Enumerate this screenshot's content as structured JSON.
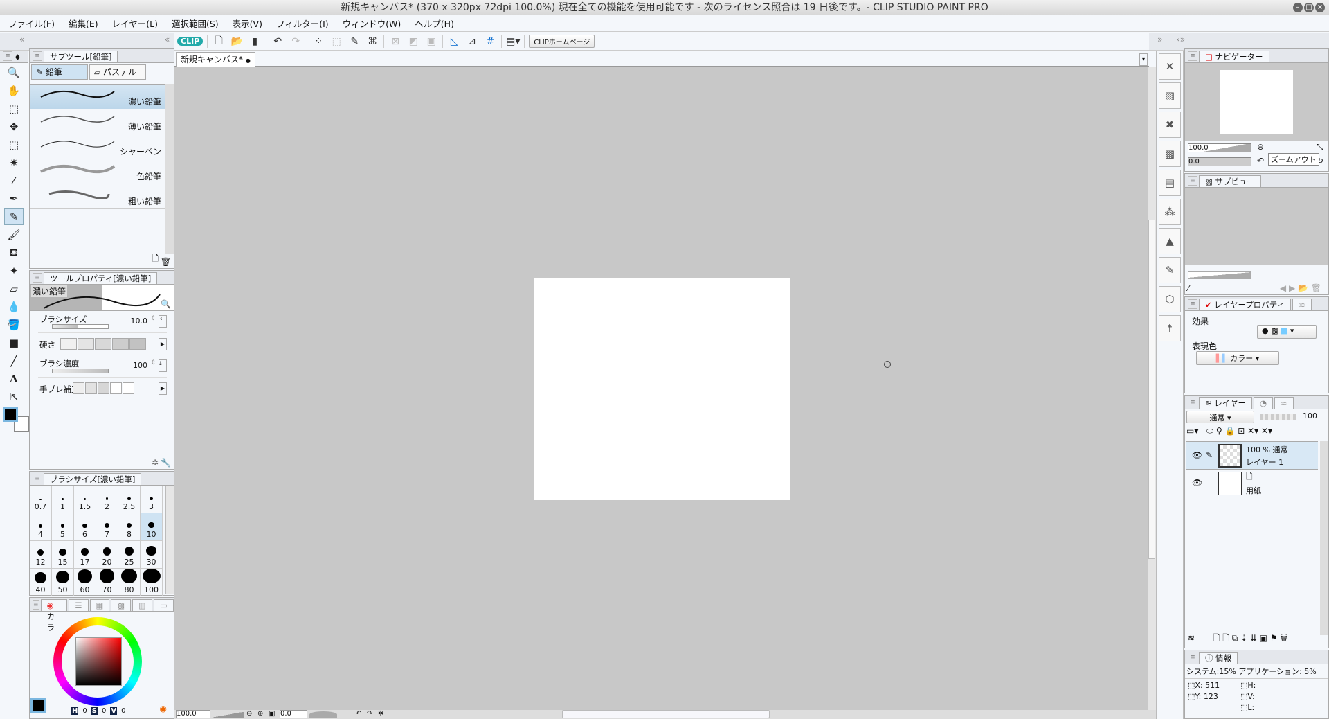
{
  "window": {
    "title": "新規キャンバス* (370 x 320px 72dpi 100.0%)  現在全ての機能を使用可能です - 次のライセンス照合は 19 日後です。- CLIP STUDIO PAINT PRO"
  },
  "menu": [
    "ファイル(F)",
    "編集(E)",
    "レイヤー(L)",
    "選択範囲(S)",
    "表示(V)",
    "フィルター(I)",
    "ウィンドウ(W)",
    "ヘルプ(H)"
  ],
  "toolbar": {
    "clip_logo": "CLIP",
    "home_button": "CLIPホームページ"
  },
  "canvas_tab": {
    "label": "新規キャンバス*",
    "dot": "●"
  },
  "subtool": {
    "title": "サブツール[鉛筆]",
    "groups": [
      "鉛筆",
      "パステル"
    ],
    "brushes": [
      "濃い鉛筆",
      "薄い鉛筆",
      "シャーペン",
      "色鉛筆",
      "粗い鉛筆"
    ]
  },
  "tool_property": {
    "title": "ツールプロパティ[濃い鉛筆]",
    "preset": "濃い鉛筆",
    "brush_size_label": "ブラシサイズ",
    "brush_size": "10.0",
    "hardness_label": "硬さ",
    "density_label": "ブラシ濃度",
    "density": "100",
    "stabilization_label": "手ブレ補正"
  },
  "brush_size_panel": {
    "title": "ブラシサイズ[濃い鉛筆]",
    "sizes": [
      "0.7",
      "1",
      "1.5",
      "2",
      "2.5",
      "3",
      "4",
      "5",
      "6",
      "7",
      "8",
      "10",
      "12",
      "15",
      "17",
      "20",
      "25",
      "30",
      "40",
      "50",
      "60",
      "70",
      "80",
      "100"
    ],
    "selected": "10"
  },
  "color_panel": {
    "tab": "カラ",
    "h_label": "H",
    "h": "0",
    "s_label": "S",
    "s": "0",
    "v_label": "V",
    "v": "0",
    "main_color": "#000000",
    "sub_color": "#ffffff"
  },
  "statusbar": {
    "zoom": "100.0",
    "rotation": "0.0"
  },
  "navigator": {
    "title": "ナビゲーター",
    "zoom": "100.0",
    "rotation": "0.0",
    "tooltip": "ズームアウト"
  },
  "subview": {
    "title": "サブビュー"
  },
  "layer_property": {
    "title": "レイヤープロパティ",
    "effect_label": "効果",
    "expression_label": "表現色",
    "expression": "カラー"
  },
  "layers": {
    "title": "レイヤー",
    "blend": "通常",
    "opacity": "100",
    "items": [
      {
        "info": "100 %  通常",
        "name": "レイヤー 1"
      },
      {
        "info": "",
        "name": "用紙"
      }
    ]
  },
  "info": {
    "title": "情報",
    "usage": "システム:15%  アプリケーション: 5%",
    "x": "X: 511",
    "y": "Y: 123",
    "h": "H:",
    "v": "V:",
    "l": "L:"
  }
}
